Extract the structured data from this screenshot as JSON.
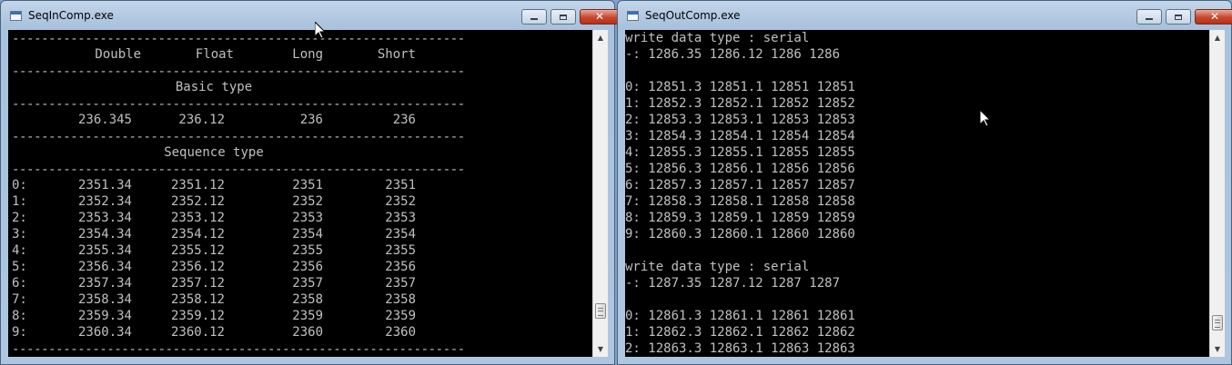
{
  "left_window": {
    "title": "SeqInComp.exe",
    "buttons": {
      "minimize": "minimize",
      "maximize": "maximize",
      "close": "✕"
    },
    "dash_line": "--------------------------------------------------------------",
    "headers": [
      "Double",
      "Float",
      "Long",
      "Short"
    ],
    "basic_label": "Basic type",
    "basic_values": [
      "236.345",
      "236.12",
      "236",
      "236"
    ],
    "sequence_label": "Sequence type",
    "rows": [
      {
        "idx": "0:",
        "d": "2351.34",
        "f": "2351.12",
        "l": "2351",
        "s": "2351"
      },
      {
        "idx": "1:",
        "d": "2352.34",
        "f": "2352.12",
        "l": "2352",
        "s": "2352"
      },
      {
        "idx": "2:",
        "d": "2353.34",
        "f": "2353.12",
        "l": "2353",
        "s": "2353"
      },
      {
        "idx": "3:",
        "d": "2354.34",
        "f": "2354.12",
        "l": "2354",
        "s": "2354"
      },
      {
        "idx": "4:",
        "d": "2355.34",
        "f": "2355.12",
        "l": "2355",
        "s": "2355"
      },
      {
        "idx": "5:",
        "d": "2356.34",
        "f": "2356.12",
        "l": "2356",
        "s": "2356"
      },
      {
        "idx": "6:",
        "d": "2357.34",
        "f": "2357.12",
        "l": "2357",
        "s": "2357"
      },
      {
        "idx": "7:",
        "d": "2358.34",
        "f": "2358.12",
        "l": "2358",
        "s": "2358"
      },
      {
        "idx": "8:",
        "d": "2359.34",
        "f": "2359.12",
        "l": "2359",
        "s": "2359"
      },
      {
        "idx": "9:",
        "d": "2360.34",
        "f": "2360.12",
        "l": "2360",
        "s": "2360"
      }
    ],
    "scroll_position": 0.92
  },
  "right_window": {
    "title": "SeqOutComp.exe",
    "buttons": {
      "minimize": "minimize",
      "maximize": "maximize",
      "close": "✕"
    },
    "lines": [
      "write data type : serial",
      "-: 1286.35 1286.12 1286 1286",
      "",
      "0: 12851.3 12851.1 12851 12851",
      "1: 12852.3 12852.1 12852 12852",
      "2: 12853.3 12853.1 12853 12853",
      "3: 12854.3 12854.1 12854 12854",
      "4: 12855.3 12855.1 12855 12855",
      "5: 12856.3 12856.1 12856 12856",
      "6: 12857.3 12857.1 12857 12857",
      "7: 12858.3 12858.1 12858 12858",
      "8: 12859.3 12859.1 12859 12859",
      "9: 12860.3 12860.1 12860 12860",
      "",
      "write data type : serial",
      "-: 1287.35 1287.12 1287 1287",
      "",
      "0: 12861.3 12861.1 12861 12861",
      "1: 12862.3 12862.1 12862 12862",
      "2: 12863.3 12863.1 12863 12863"
    ],
    "scroll_position": 0.96
  },
  "colors": {
    "console_bg": "#000000",
    "console_text": "#c0c0c0",
    "close_button": "#c8462d",
    "frame": "#a9c2dd"
  },
  "icons": [
    "console-app-icon",
    "minimize-icon",
    "maximize-icon",
    "close-icon",
    "scroll-up-arrow-icon",
    "scroll-down-arrow-icon",
    "mouse-pointer-icon"
  ]
}
